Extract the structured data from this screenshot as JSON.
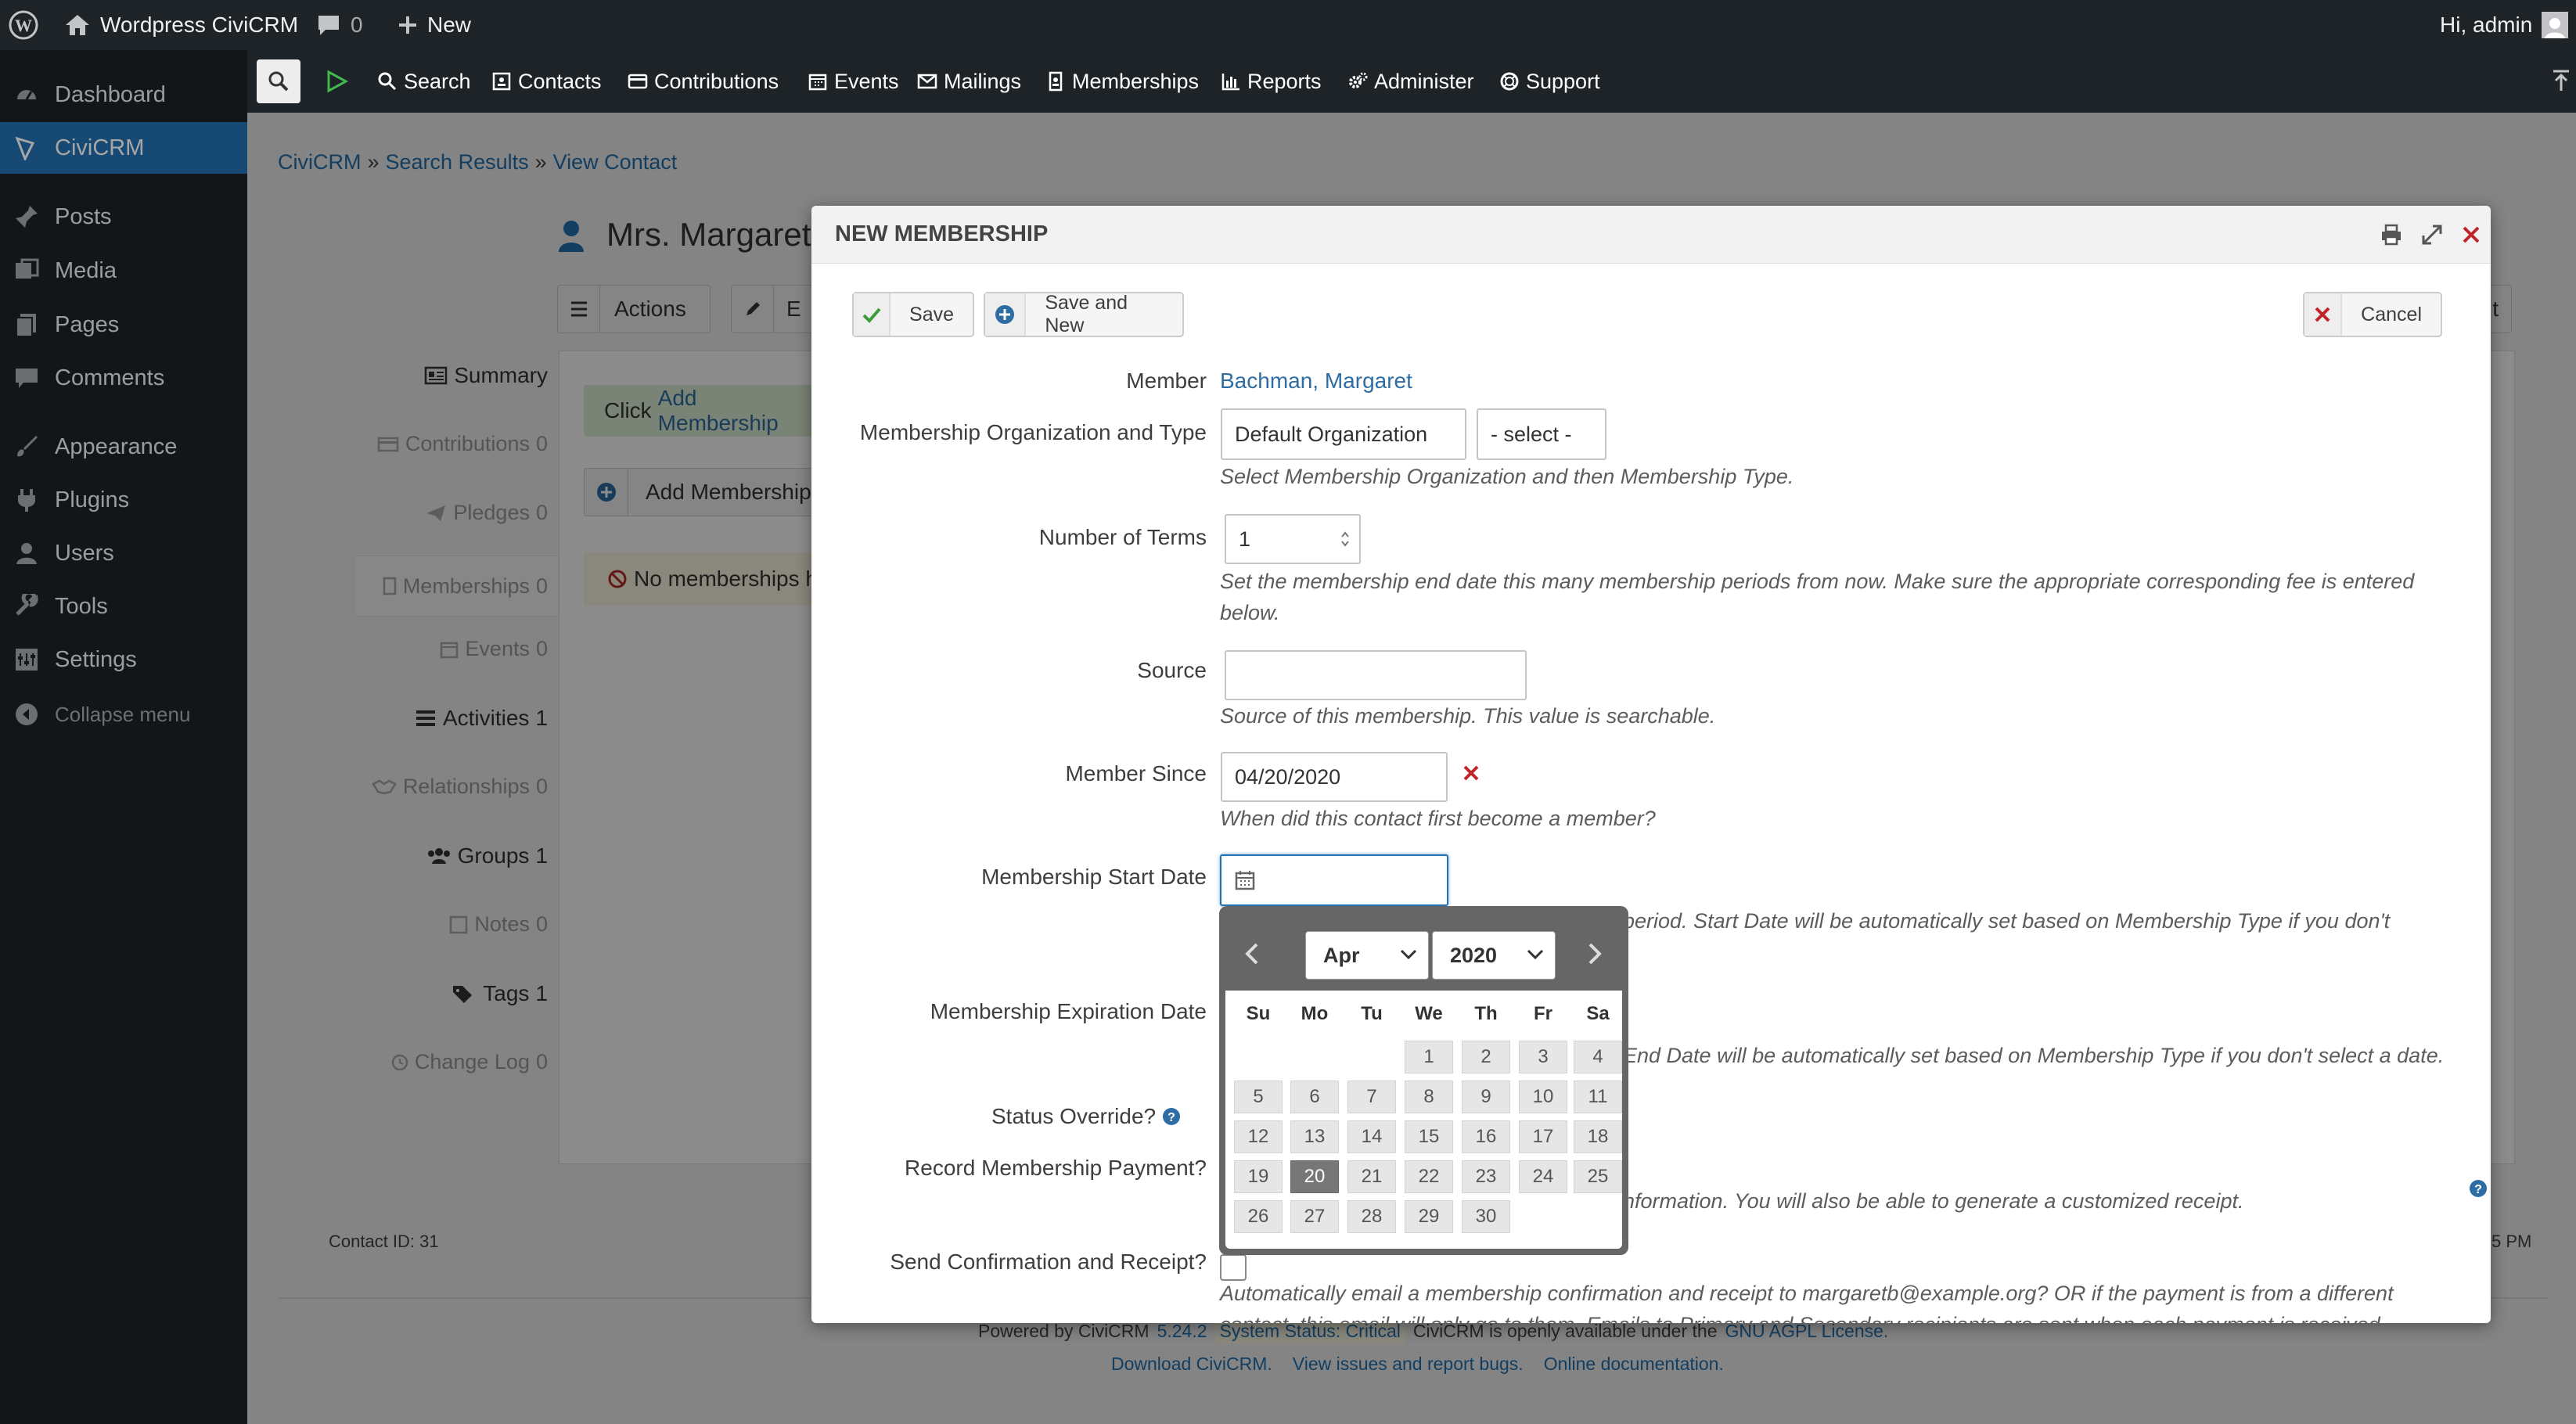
{
  "adminbar": {
    "site_name": "Wordpress CiviCRM",
    "comments_count": "0",
    "new_label": "New",
    "greeting": "Hi, admin"
  },
  "wp_menu": {
    "items": [
      {
        "label": "Dashboard",
        "icon": "dashboard-icon"
      },
      {
        "label": "CiviCRM",
        "icon": "civicrm-icon"
      },
      {
        "label": "Posts",
        "icon": "pin-icon"
      },
      {
        "label": "Media",
        "icon": "media-icon"
      },
      {
        "label": "Pages",
        "icon": "pages-icon"
      },
      {
        "label": "Comments",
        "icon": "comment-icon"
      },
      {
        "label": "Appearance",
        "icon": "brush-icon"
      },
      {
        "label": "Plugins",
        "icon": "plug-icon"
      },
      {
        "label": "Users",
        "icon": "user-icon"
      },
      {
        "label": "Tools",
        "icon": "wrench-icon"
      },
      {
        "label": "Settings",
        "icon": "settings-icon"
      },
      {
        "label": "Collapse menu",
        "icon": "collapse-icon"
      }
    ]
  },
  "civi_nav": {
    "items": [
      {
        "label": "Search",
        "icon": "search-icon"
      },
      {
        "label": "Contacts",
        "icon": "contacts-icon"
      },
      {
        "label": "Contributions",
        "icon": "credit-card-icon"
      },
      {
        "label": "Events",
        "icon": "calendar-icon"
      },
      {
        "label": "Mailings",
        "icon": "envelope-icon"
      },
      {
        "label": "Memberships",
        "icon": "id-badge-icon"
      },
      {
        "label": "Reports",
        "icon": "bar-chart-icon"
      },
      {
        "label": "Administer",
        "icon": "cogs-icon"
      },
      {
        "label": "Support",
        "icon": "lifebuoy-icon"
      }
    ]
  },
  "breadcrumb": {
    "part1": "CiviCRM",
    "sep1": "»",
    "part2": "Search Results",
    "sep2": "»",
    "part3": "View Contact"
  },
  "contact": {
    "name": "Mrs. Margaret",
    "actions_label": "Actions",
    "edit_label": "E",
    "right_frag": "t",
    "contact_id": "Contact ID: 31",
    "time_frag": "5 PM",
    "tabs": [
      {
        "label": "Summary",
        "count": ""
      },
      {
        "label": "Contributions",
        "count": "0"
      },
      {
        "label": "Pledges",
        "count": "0"
      },
      {
        "label": "Memberships",
        "count": "0"
      },
      {
        "label": "Events",
        "count": "0"
      },
      {
        "label": "Activities",
        "count": "1"
      },
      {
        "label": "Relationships",
        "count": "0"
      },
      {
        "label": "Groups",
        "count": "1"
      },
      {
        "label": "Notes",
        "count": "0"
      },
      {
        "label": "Tags",
        "count": "1"
      },
      {
        "label": "Change Log",
        "count": "0"
      }
    ],
    "click_text": "Click",
    "add_membership_link": "Add Membership",
    "add_membership_btn": "Add Membership",
    "no_memberships": "No memberships h"
  },
  "footer": {
    "powered_by": "Powered by CiviCRM",
    "version": "5.24.2",
    "status": "System Status: Critical",
    "license_text": "CiviCRM is openly available under the",
    "license_link": "GNU AGPL License.",
    "download": "Download CiviCRM.",
    "issues": "View issues and report bugs.",
    "docs": "Online documentation."
  },
  "dialog": {
    "title": "NEW MEMBERSHIP",
    "save_label": "Save",
    "save_new_label": "Save and New",
    "cancel_label": "Cancel",
    "member_label": "Member",
    "member_value": "Bachman, Margaret",
    "org_type_label": "Membership Organization and Type",
    "org_value": "Default Organization",
    "type_value": "- select -",
    "org_help": "Select Membership Organization and then Membership Type.",
    "terms_label": "Number of Terms",
    "terms_value": "1",
    "terms_help": "Set the membership end date this many membership periods from now. Make sure the appropriate corresponding fee is entered below.",
    "source_label": "Source",
    "source_value": "",
    "source_help": "Source of this membership. This value is searchable.",
    "member_since_label": "Member Since",
    "member_since_value": "04/20/2020",
    "member_since_help": "When did this contact first become a member?",
    "start_date_label": "Membership Start Date",
    "start_date_help": "period. Start Date will be automatically set based on Membership Type if you don't",
    "expiration_label": "Membership Expiration Date",
    "expiration_help": "End Date will be automatically set based on Membership Type if you don't select a date.",
    "status_override_label": "Status Override?",
    "record_payment_label": "Record Membership Payment?",
    "record_payment_help": "nformation. You will also be able to generate a customized receipt.",
    "send_confirm_label": "Send Confirmation and Receipt?",
    "send_confirm_help": "Automatically email a membership confirmation and receipt to margaretb@example.org? OR if the payment is from a different",
    "send_confirm_help2": "contact, this email will only go to them. Emails to Primary and Secondary recipients are sent when each payment is received."
  },
  "datepicker": {
    "month": "Apr",
    "year": "2020",
    "weekdays": [
      "Su",
      "Mo",
      "Tu",
      "We",
      "Th",
      "Fr",
      "Sa"
    ],
    "days": [
      "1",
      "2",
      "3",
      "4",
      "5",
      "6",
      "7",
      "8",
      "9",
      "10",
      "11",
      "12",
      "13",
      "14",
      "15",
      "16",
      "17",
      "18",
      "19",
      "20",
      "21",
      "22",
      "23",
      "24",
      "25",
      "26",
      "27",
      "28",
      "29",
      "30"
    ],
    "first_weekday": 3,
    "selected_day": "20"
  },
  "colors": {
    "wp_dark": "#1d2327",
    "wp_accent": "#2271b1",
    "save_green": "#3a9d3a",
    "cancel_red": "#c0242b"
  }
}
